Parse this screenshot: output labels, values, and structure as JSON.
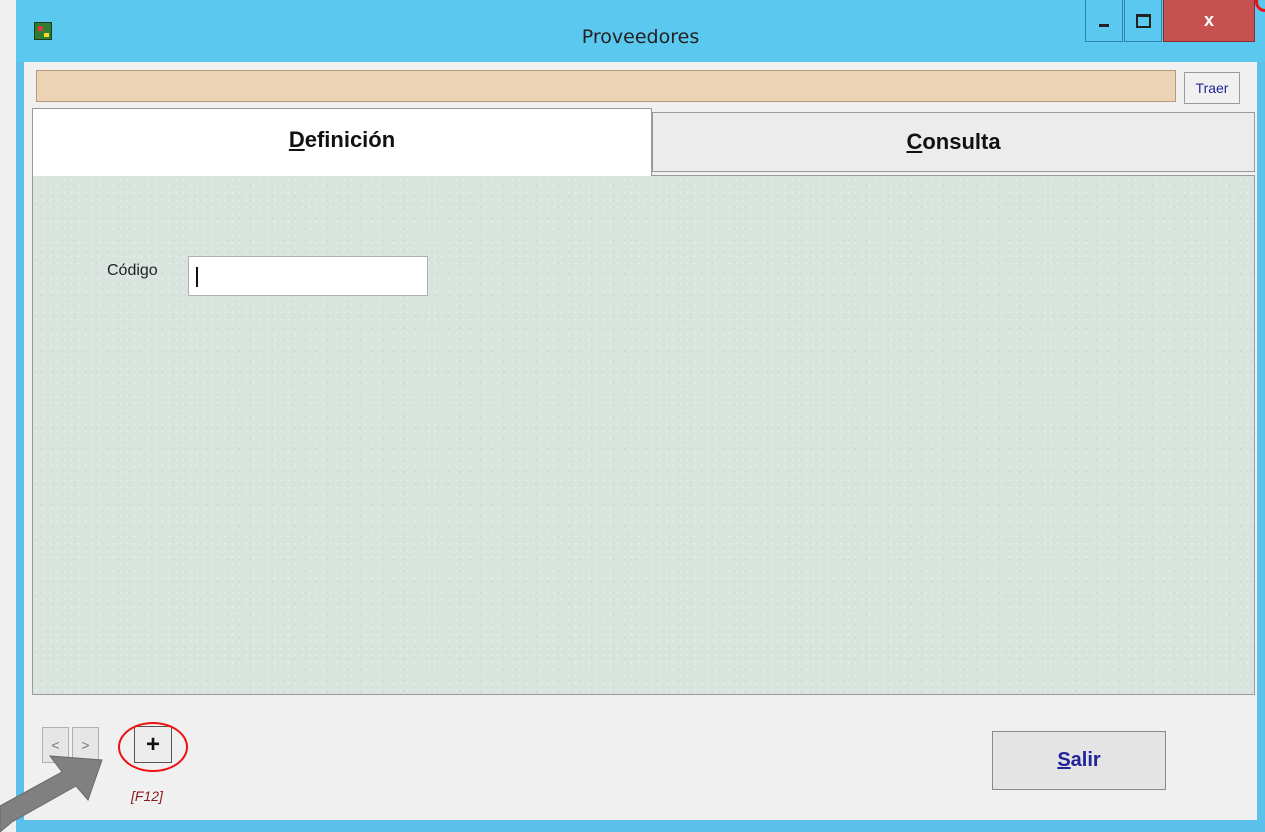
{
  "window": {
    "title": "Proveedores",
    "close_glyph": "x",
    "app_icon": "app-icon"
  },
  "toolbar": {
    "traer_label": "Traer"
  },
  "tabs": [
    {
      "mnemonic": "D",
      "rest": "efinición",
      "active": true
    },
    {
      "mnemonic": "C",
      "rest": "onsulta",
      "active": false
    }
  ],
  "form": {
    "codigo_label": "Código",
    "codigo_value": ""
  },
  "nav": {
    "prev_label": "<",
    "next_label": ">",
    "add_label": "+",
    "add_shortcut": "[F12]"
  },
  "actions": {
    "salir_mnemonic": "S",
    "salir_rest": "alir"
  },
  "annotation": {
    "highlight_color": "#ee1111",
    "arrow_color": "#808080"
  }
}
